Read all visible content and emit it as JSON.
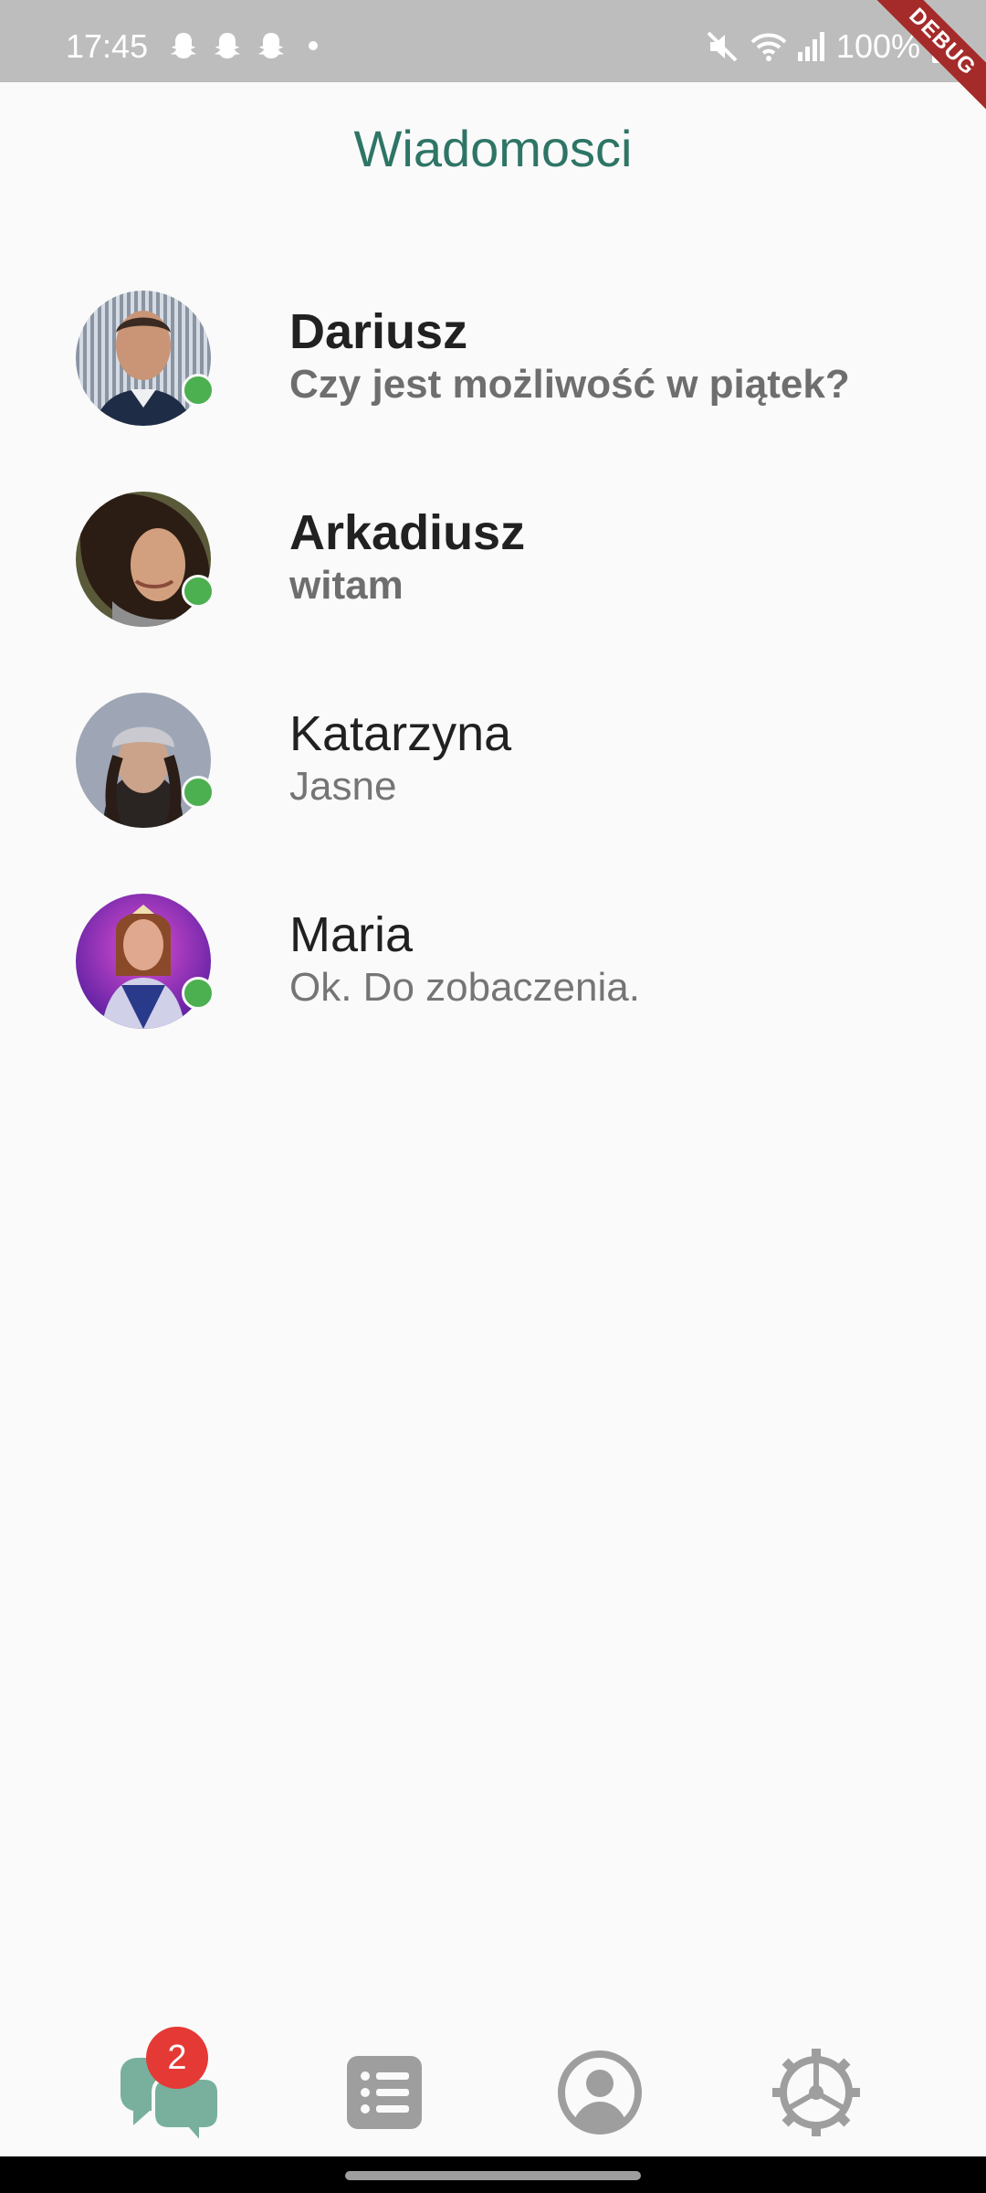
{
  "status_bar": {
    "time": "17:45",
    "battery": "100%",
    "left_icons": [
      "snapchat-icon",
      "snapchat-icon",
      "snapchat-icon",
      "dot-icon"
    ],
    "right_icons": [
      "mute-icon",
      "wifi-icon",
      "signal-icon",
      "battery-icon"
    ],
    "debug_label": "DEBUG"
  },
  "header": {
    "title": "Wiadomosci"
  },
  "chats": [
    {
      "name": "Dariusz",
      "message": "Czy jest możliwość w piątek?",
      "unread": true,
      "online": true
    },
    {
      "name": "Arkadiusz",
      "message": "witam",
      "unread": true,
      "online": true
    },
    {
      "name": "Katarzyna",
      "message": "Jasne",
      "unread": false,
      "online": true
    },
    {
      "name": "Maria",
      "message": "Ok. Do zobaczenia.",
      "unread": false,
      "online": true
    }
  ],
  "bottom_nav": {
    "items": [
      {
        "icon": "chat-bubbles-icon",
        "badge": "2",
        "active": true
      },
      {
        "icon": "list-icon",
        "active": false
      },
      {
        "icon": "profile-icon",
        "active": false
      },
      {
        "icon": "settings-gear-icon",
        "active": false
      }
    ]
  },
  "colors": {
    "accent": "#2e7566",
    "nav_active": "#78b09d",
    "nav_inactive": "#9e9e9e",
    "online": "#4caf50",
    "badge": "#e53935",
    "status_bar": "#bdbdbd"
  }
}
